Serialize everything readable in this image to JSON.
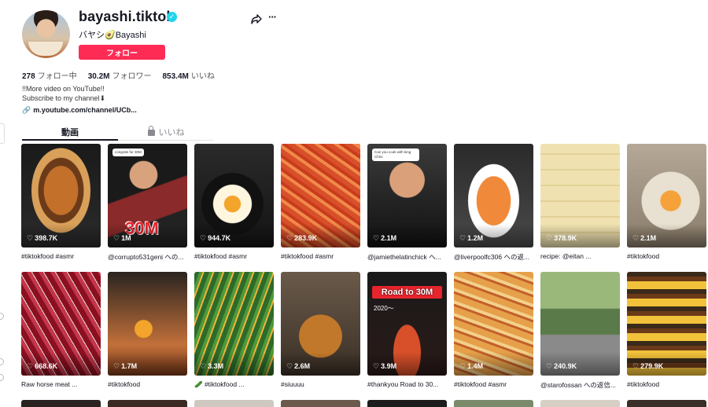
{
  "profile": {
    "username": "bayashi.tiktok",
    "nickname": "バヤシ🥑Bayashi",
    "follow_label": "フォロー",
    "verified_icon": "verified-badge-icon",
    "stats": [
      {
        "value": "278",
        "label": "フォロー中"
      },
      {
        "value": "30.2M",
        "label": "フォロワー"
      },
      {
        "value": "853.4M",
        "label": "いいね"
      }
    ],
    "bio_lines": [
      "!!More video on YouTube!!",
      "Subscribe to my channel⬇"
    ],
    "link": "m.youtube.com/channel/UCb..."
  },
  "tabs": {
    "videos": "動画",
    "liked": "いいね"
  },
  "videos": [
    {
      "views": "398.7K",
      "caption": "#tiktokfood #asmr"
    },
    {
      "views": "1M",
      "caption": "@corrupto531geni への...",
      "overlay": "30M",
      "bubble": "congrats for 30M"
    },
    {
      "views": "944.7K",
      "caption": "#tiktokfood #asmr"
    },
    {
      "views": "283.9K",
      "caption": "#tiktokfood #asmr"
    },
    {
      "views": "2.1M",
      "caption": "@jamiethelatinchick へ...",
      "bubble": "Can you cook with king Chris"
    },
    {
      "views": "1.2M",
      "caption": "@liverpoolfc306 への返..."
    },
    {
      "views": "378.9K",
      "caption": "recipe: @eitan ..."
    },
    {
      "views": "2.1M",
      "caption": "#tiktokfood"
    },
    {
      "views": "668.6K",
      "caption": "Raw horse meat ..."
    },
    {
      "views": "1.7M",
      "caption": "#tiktokfood"
    },
    {
      "views": "3.3M",
      "caption": "🥒 #tiktokfood ..."
    },
    {
      "views": "2.6M",
      "caption": "#siuuuu"
    },
    {
      "views": "3.9M",
      "caption": "#thankyou Road to 30...",
      "overlay": "Road to 30M",
      "overlay_sub": "2020〜"
    },
    {
      "views": "1.4M",
      "caption": "#tiktokfood #asmr"
    },
    {
      "views": "240.9K",
      "caption": "@starofossan への返信..."
    },
    {
      "views": "279.9K",
      "caption": "#tiktokfood"
    }
  ]
}
